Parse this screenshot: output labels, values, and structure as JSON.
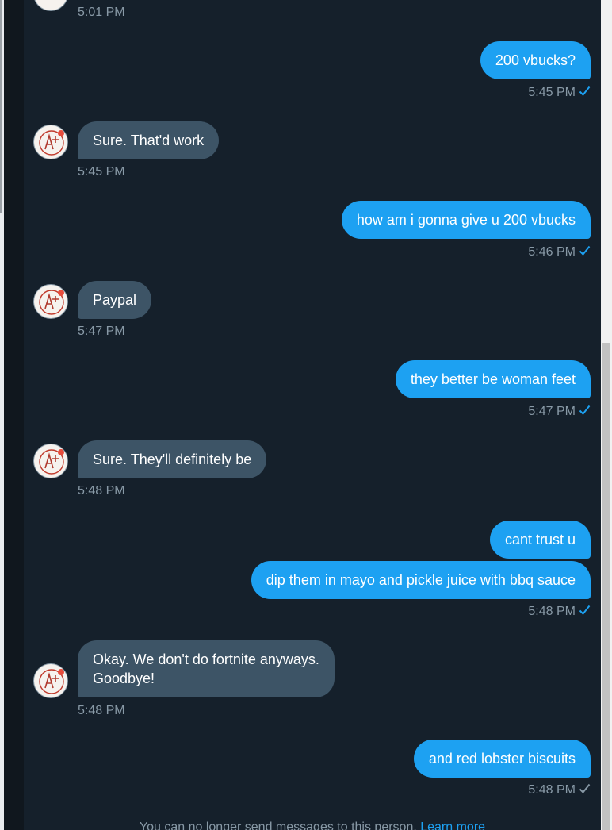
{
  "thread": {
    "top_time": "5:01 PM",
    "messages": [
      {
        "side": "out",
        "text": "200 vbucks?",
        "time": "5:45 PM",
        "status": "read"
      },
      {
        "side": "in",
        "text": "Sure. That'd work",
        "time": "5:45 PM"
      },
      {
        "side": "out",
        "text": "how am i gonna give u 200 vbucks",
        "time": "5:46 PM",
        "status": "read"
      },
      {
        "side": "in",
        "text": "Paypal",
        "time": "5:47 PM"
      },
      {
        "side": "out",
        "text": "they better be woman feet",
        "time": "5:47 PM",
        "status": "read"
      },
      {
        "side": "in",
        "text": "Sure. They'll definitely be",
        "time": "5:48 PM"
      },
      {
        "side": "out",
        "text": "cant trust u"
      },
      {
        "side": "out",
        "text": "dip them in mayo and pickle juice with bbq sauce",
        "time": "5:48 PM",
        "status": "read"
      },
      {
        "side": "in",
        "lines": [
          "Okay. We don't do fortnite anyways.",
          "Goodbye!"
        ],
        "time": "5:48 PM"
      },
      {
        "side": "out",
        "text": "and red lobster biscuits",
        "time": "5:48 PM",
        "status": "sent"
      }
    ]
  },
  "footer": {
    "notice": "You can no longer send messages to this person.",
    "link": "Learn more"
  },
  "colors": {
    "background": "#15202b",
    "outgoing_bubble": "#1da1f2",
    "incoming_bubble": "#3d5466",
    "timestamp": "#8899a6",
    "read_check": "#1da1f2",
    "sent_check": "#8899a6"
  },
  "icons": {
    "read": "check-icon",
    "avatar": "grade-a-plus-avatar"
  }
}
